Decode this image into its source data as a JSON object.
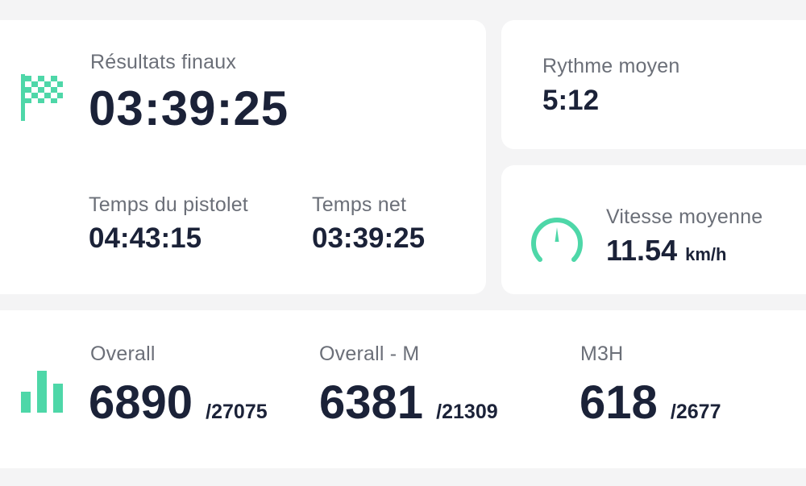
{
  "results": {
    "final_label": "Résultats finaux",
    "final_time": "03:39:25",
    "gun_label": "Temps du pistolet",
    "gun_time": "04:43:15",
    "net_label": "Temps net",
    "net_time": "03:39:25"
  },
  "pace": {
    "label": "Rythme moyen",
    "value": "5:12"
  },
  "speed": {
    "label": "Vitesse moyenne",
    "value": "11.54",
    "unit": "km/h"
  },
  "rankings": [
    {
      "label": "Overall",
      "rank": "6890",
      "total": "/27075"
    },
    {
      "label": "Overall - M",
      "rank": "6381",
      "total": "/21309"
    },
    {
      "label": "M3H",
      "rank": "618",
      "total": "/2677"
    }
  ],
  "icons": {
    "flag": "checkered-flag-icon",
    "speed": "speedometer-icon",
    "rank": "bar-chart-icon"
  },
  "colors": {
    "accent": "#4ed7a8",
    "background": "#f4f4f5",
    "card": "#ffffff",
    "text_primary": "#1b2238",
    "text_secondary": "#6b6f78"
  }
}
